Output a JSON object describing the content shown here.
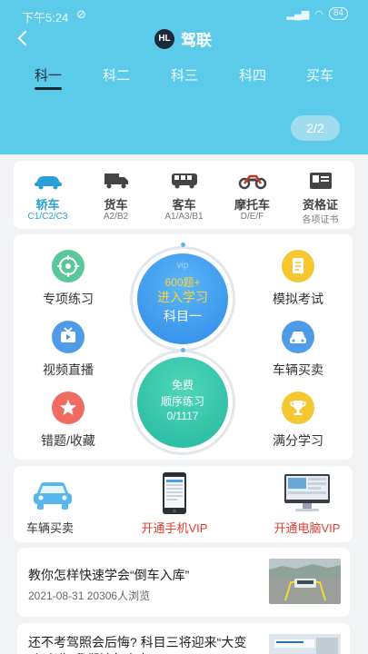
{
  "status": {
    "time": "下午5:24",
    "battery": "84"
  },
  "header": {
    "title": "驾联",
    "logo_text": "HL"
  },
  "tabs": [
    {
      "label": "科一",
      "active": true
    },
    {
      "label": "科二",
      "active": false
    },
    {
      "label": "科三",
      "active": false
    },
    {
      "label": "科四",
      "active": false
    },
    {
      "label": "买车",
      "active": false
    }
  ],
  "page_indicator": "2/2",
  "vehicles": [
    {
      "label": "轿车",
      "sub": "C1/C2/C3",
      "icon": "car-icon",
      "active": true
    },
    {
      "label": "货车",
      "sub": "A2/B2",
      "icon": "truck-icon",
      "active": false
    },
    {
      "label": "客车",
      "sub": "A1/A3/B1",
      "icon": "bus-icon",
      "active": false
    },
    {
      "label": "摩托车",
      "sub": "D/E/F",
      "icon": "motorcycle-icon",
      "active": false
    },
    {
      "label": "资格证",
      "sub": "各项证书",
      "icon": "certificate-icon",
      "active": false
    }
  ],
  "features": {
    "special": "专项练习",
    "video": "视频直播",
    "mistakes": "错题/收藏",
    "mock": "模拟考试",
    "buy": "车辆买卖",
    "full": "满分学习"
  },
  "center": {
    "vip": "vip",
    "questions": "600题+",
    "enter": "进入学习",
    "subject": "科目一",
    "free": "免费",
    "order": "顺序练习",
    "progress": "0/1117"
  },
  "promos": {
    "buy": "车辆买卖",
    "phone_vip": "开通手机VIP",
    "pc_vip": "开通电脑VIP"
  },
  "news": [
    {
      "title": "教你怎样快速学会“倒车入库”",
      "date": "2021-08-31",
      "views": "20306人浏览"
    },
    {
      "title": "还不考驾照会后悔? 科目三将迎来“大变动”考生 我们该怎么办?"
    }
  ],
  "colors": {
    "header": "#5ccbea",
    "accent": "#2a9fd6",
    "vip_red": "#e63b2e"
  }
}
